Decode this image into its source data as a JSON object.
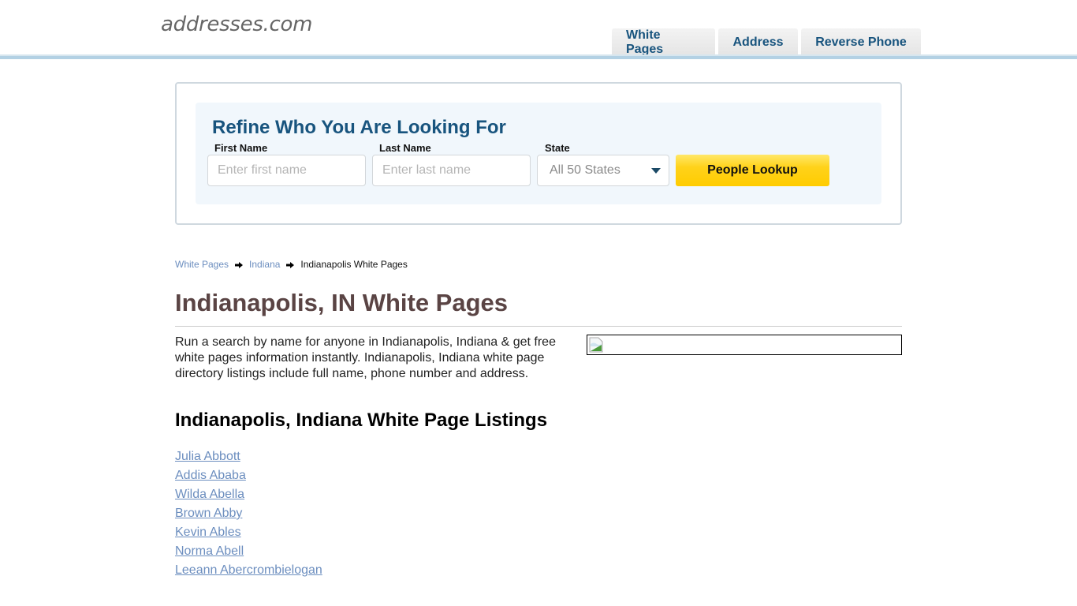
{
  "header": {
    "logo": "addresses.com",
    "nav": [
      {
        "label": "White Pages"
      },
      {
        "label": "Address"
      },
      {
        "label": "Reverse Phone"
      }
    ]
  },
  "search": {
    "title": "Refine Who You Are Looking For",
    "first_name_label": "First Name",
    "first_name_placeholder": "Enter first name",
    "first_name_value": "",
    "last_name_label": "Last Name",
    "last_name_placeholder": "Enter last name",
    "last_name_value": "",
    "state_label": "State",
    "state_selected": "All 50 States",
    "button_label": "People Lookup"
  },
  "breadcrumb": {
    "items": [
      {
        "label": "White Pages",
        "link": true
      },
      {
        "label": "Indiana",
        "link": true
      },
      {
        "label": "Indianapolis White Pages",
        "link": false
      }
    ]
  },
  "main": {
    "title": "Indianapolis, IN White Pages",
    "intro": "Run a search by name for anyone in Indianapolis, Indiana & get free white pages information instantly. Indianapolis, Indiana white page directory listings include full name, phone number and address.",
    "listings_title": "Indianapolis, Indiana White Page Listings",
    "listings": [
      "Julia Abbott",
      "Addis Ababa",
      "Wilda Abella",
      "Brown Abby",
      "Kevin Ables",
      "Norma Abell",
      "Leeann Abercrombielogan"
    ]
  },
  "colors": {
    "brand_blue": "#18547e",
    "link": "#6c8ebf",
    "title": "#5a4444",
    "button_yellow": "#ffcc00",
    "header_line": "#b3d1e4"
  }
}
